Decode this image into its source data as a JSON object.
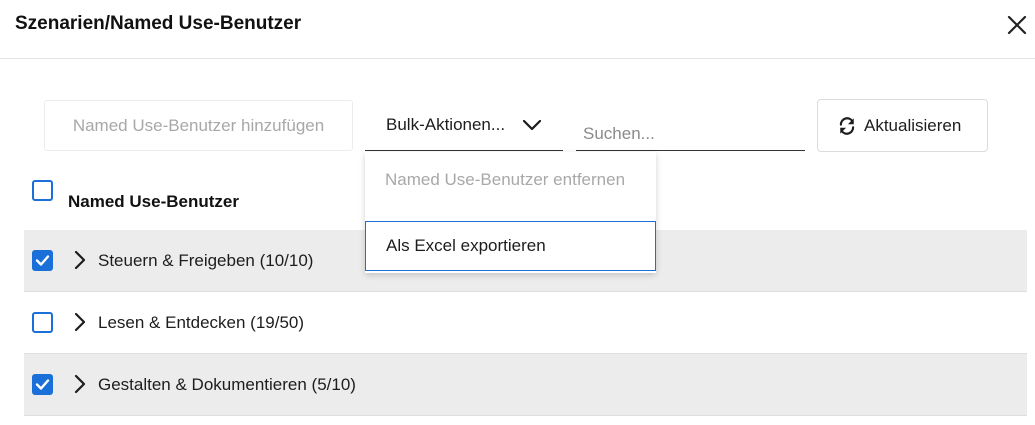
{
  "dialog": {
    "title": "Szenarien/Named Use-Benutzer"
  },
  "toolbar": {
    "add_label": "Named Use-Benutzer hinzufügen",
    "bulk_label": "Bulk-Aktionen...",
    "search_placeholder": "Suchen...",
    "search_value": "",
    "refresh_label": "Aktualisieren"
  },
  "bulk_menu": {
    "items": [
      {
        "label": "Named Use-Benutzer entfernen",
        "disabled": true
      },
      {
        "label": "Als Excel exportieren",
        "disabled": false,
        "focused": true
      }
    ]
  },
  "list": {
    "column_title": "Named Use-Benutzer",
    "select_all_checked": false,
    "rows": [
      {
        "label": "Steuern & Freigeben (10/10)",
        "checked": true
      },
      {
        "label": "Lesen & Entdecken (19/50)",
        "checked": false
      },
      {
        "label": "Gestalten & Dokumentieren (5/10)",
        "checked": true
      }
    ]
  },
  "colors": {
    "accent": "#1a6fd8",
    "row_alt": "#ececec",
    "disabled_text": "#a8a8a8"
  }
}
